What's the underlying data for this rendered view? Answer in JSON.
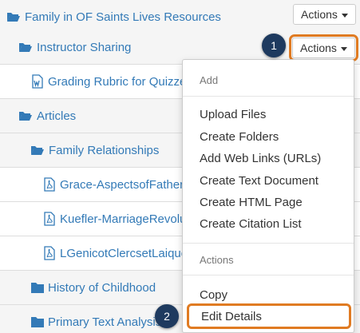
{
  "tree": {
    "rows": [
      {
        "label": "Family in OF Saints Lives Resources",
        "icon": "folder-open-icon"
      },
      {
        "label": "Instructor Sharing",
        "icon": "folder-open-icon"
      },
      {
        "label": "Grading Rubric for Quizzes",
        "icon": "word-document-icon"
      },
      {
        "label": "Articles",
        "icon": "folder-open-icon"
      },
      {
        "label": "Family Relationships",
        "icon": "folder-open-icon"
      },
      {
        "label": "Grace-AspectsofFatherhood",
        "icon": "pdf-document-icon"
      },
      {
        "label": "Kuefler-MarriageRevolution",
        "icon": "pdf-document-icon"
      },
      {
        "label": "LGenicotClercsetLaiques",
        "icon": "pdf-document-icon"
      },
      {
        "label": "History of Childhood",
        "icon": "folder-closed-icon"
      },
      {
        "label": "Primary Text Analysis",
        "icon": "folder-closed-icon"
      }
    ]
  },
  "actions": {
    "top_label": "Actions",
    "instructor_label": "Actions"
  },
  "dropdown": {
    "add_header": "Add",
    "add_items": [
      "Upload Files",
      "Create Folders",
      "Add Web Links (URLs)",
      "Create Text Document",
      "Create HTML Page",
      "Create Citation List"
    ],
    "actions_header": "Actions",
    "copy": "Copy",
    "edit_details": "Edit Details"
  },
  "callouts": {
    "step1": "1",
    "step2": "2"
  },
  "colors": {
    "link": "#337ab7",
    "highlight": "#e07b22",
    "badge": "#1e3a5f"
  }
}
